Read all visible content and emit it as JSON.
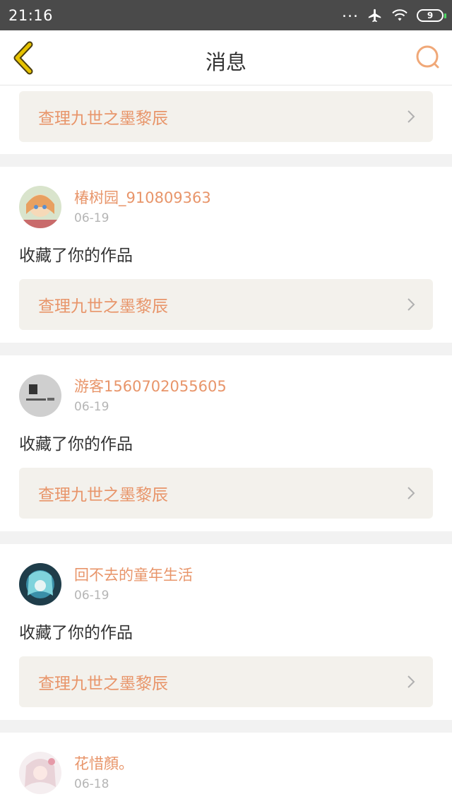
{
  "status_bar": {
    "time": "21:16",
    "dots": "...",
    "battery": "9"
  },
  "header": {
    "title": "消息",
    "back_icon": "chevron-left-icon",
    "search_icon": "search-icon"
  },
  "colors": {
    "accent": "#e8956a",
    "back_icon": "#c9a400",
    "ref_bg": "#f3f1ec"
  },
  "feed": {
    "first_ref": "查理九世之墨黎辰",
    "items": [
      {
        "username": "椿树园_910809363",
        "date": "06-19",
        "action": "收藏了你的作品",
        "ref": "查理九世之墨黎辰"
      },
      {
        "username": "游客1560702055605",
        "date": "06-19",
        "action": "收藏了你的作品",
        "ref": "查理九世之墨黎辰"
      },
      {
        "username": "回不去的童年生活",
        "date": "06-19",
        "action": "收藏了你的作品",
        "ref": "查理九世之墨黎辰"
      },
      {
        "username": "花惜顏。",
        "date": "06-18"
      }
    ]
  }
}
